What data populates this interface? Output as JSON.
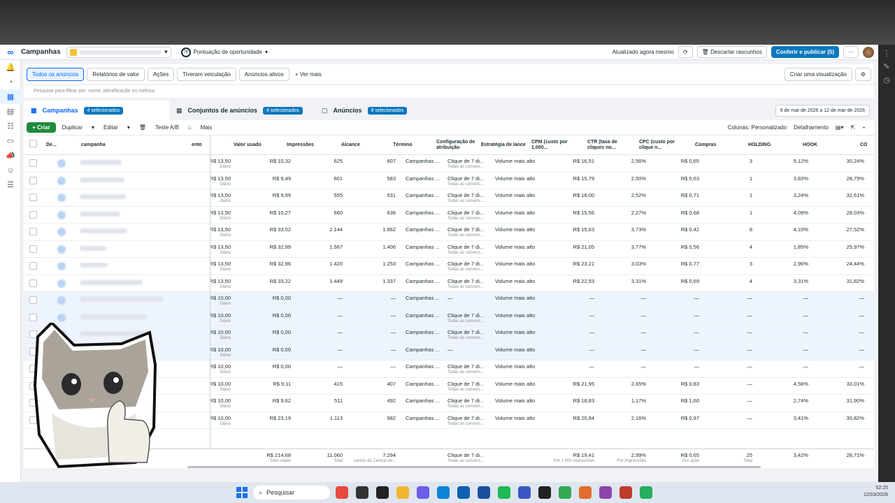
{
  "header": {
    "title": "Campanhas",
    "score_value": "78",
    "score_label": "Pontuação de oportunidade",
    "updated": "Atualizado agora mesmo",
    "discard": "Descartar rascunhos",
    "publish": "Conferir e publicar (5)"
  },
  "tabs": [
    "Todos os anúncios",
    "Relatórios de valor",
    "Ações",
    "Tiveram veiculação",
    "Anúncios ativos",
    "+ Ver mais"
  ],
  "create_view": "Criar uma visualização",
  "filter_placeholder": "Pesquise para filtrar por: nome, identificação ou métrica",
  "levels": {
    "campaigns": "Campanhas",
    "campaigns_sel": "4 selecionados",
    "adsets": "Conjuntos de anúncios",
    "adsets_sel": "4 selecionados",
    "ads": "Anúncios",
    "ads_sel": "8 selecionados",
    "date_range": "9 de mar de 2026 a 12 de mar de 2026"
  },
  "actions": {
    "create": "+ Criar",
    "duplicate": "Duplicar",
    "edit": "Editar",
    "abtest": "Teste A/B",
    "more": "Mais",
    "columns": "Colunas: Personalizado",
    "breakdown": "Detalhamento"
  },
  "columns": [
    "De...",
    "campanha",
    "ento",
    "Valor usado",
    "Impressões",
    "Alcance",
    "Término",
    "Configuração de atribuição",
    "Estratégia de lance",
    "CPM (custo por 1.000...",
    "CTR (taxa de cliques no...",
    "CPC (custo por clique n...",
    "Compras",
    "HOLDING",
    "HOOK",
    "CO"
  ],
  "rows": [
    {
      "budget": "R$ 13,50",
      "spent": "R$ 10,32",
      "impr": "625",
      "reach": "607",
      "end": "Campanhas ...",
      "attr": "Clique de 7 di...",
      "strategy": "Volume mais alto",
      "cpm": "R$ 16,51",
      "ctr": "2,56%",
      "cpc": "R$ 0,65",
      "purch": "3",
      "hold": "5,12%",
      "hook": "30,24%",
      "sel": false
    },
    {
      "budget": "R$ 13,50",
      "spent": "R$ 9,49",
      "impr": "601",
      "reach": "583",
      "end": "Campanhas ...",
      "attr": "Clique de 7 di...",
      "strategy": "Volume mais alto",
      "cpm": "R$ 15,79",
      "ctr": "2,50%",
      "cpc": "R$ 0,63",
      "purch": "1",
      "hold": "3,83%",
      "hook": "28,79%",
      "sel": false
    },
    {
      "budget": "R$ 13,50",
      "spent": "R$ 9,99",
      "impr": "555",
      "reach": "531",
      "end": "Campanhas ...",
      "attr": "Clique de 7 di...",
      "strategy": "Volume mais alto",
      "cpm": "R$ 18,00",
      "ctr": "2,52%",
      "cpc": "R$ 0,71",
      "purch": "1",
      "hold": "3,24%",
      "hook": "32,61%",
      "sel": false
    },
    {
      "budget": "R$ 13,50",
      "spent": "R$ 10,27",
      "impr": "660",
      "reach": "636",
      "end": "Campanhas ...",
      "attr": "Clique de 7 di...",
      "strategy": "Volume mais alto",
      "cpm": "R$ 15,56",
      "ctr": "2,27%",
      "cpc": "R$ 0,68",
      "purch": "1",
      "hold": "4,09%",
      "hook": "28,03%",
      "sel": false
    },
    {
      "budget": "R$ 13,50",
      "spent": "R$ 33,52",
      "impr": "2.144",
      "reach": "1.862",
      "end": "Campanhas ...",
      "attr": "Clique de 7 di...",
      "strategy": "Volume mais alto",
      "cpm": "R$ 15,63",
      "ctr": "3,73%",
      "cpc": "R$ 0,42",
      "purch": "8",
      "hold": "4,10%",
      "hook": "27,52%",
      "sel": false
    },
    {
      "budget": "R$ 13,50",
      "spent": "R$ 32,99",
      "impr": "1.567",
      "reach": "1.406",
      "end": "Campanhas ...",
      "attr": "Clique de 7 di...",
      "strategy": "Volume mais alto",
      "cpm": "R$ 21,05",
      "ctr": "3,77%",
      "cpc": "R$ 0,56",
      "purch": "4",
      "hold": "1,85%",
      "hook": "25,97%",
      "sel": false
    },
    {
      "budget": "R$ 13,50",
      "spent": "R$ 32,96",
      "impr": "1.420",
      "reach": "1.253",
      "end": "Campanhas ...",
      "attr": "Clique de 7 di...",
      "strategy": "Volume mais alto",
      "cpm": "R$ 23,21",
      "ctr": "3,03%",
      "cpc": "R$ 0,77",
      "purch": "3",
      "hold": "2,96%",
      "hook": "24,44%",
      "sel": false
    },
    {
      "budget": "R$ 13,50",
      "spent": "R$ 33,22",
      "impr": "1.449",
      "reach": "1.337",
      "end": "Campanhas ...",
      "attr": "Clique de 7 di...",
      "strategy": "Volume mais alto",
      "cpm": "R$ 22,93",
      "ctr": "3,31%",
      "cpc": "R$ 0,69",
      "purch": "4",
      "hold": "3,31%",
      "hook": "31,82%",
      "sel": false
    },
    {
      "budget": "R$ 10,00",
      "spent": "R$ 0,00",
      "impr": "—",
      "reach": "—",
      "end": "Campanhas ...",
      "attr": "—",
      "strategy": "Volume mais alto",
      "cpm": "—",
      "ctr": "—",
      "cpc": "—",
      "purch": "—",
      "hold": "—",
      "hook": "—",
      "sel": true
    },
    {
      "budget": "R$ 10,00",
      "spent": "R$ 0,00",
      "impr": "—",
      "reach": "—",
      "end": "Campanhas ...",
      "attr": "Clique de 7 di...",
      "strategy": "Volume mais alto",
      "cpm": "—",
      "ctr": "—",
      "cpc": "—",
      "purch": "—",
      "hold": "—",
      "hook": "—",
      "sel": true
    },
    {
      "budget": "R$ 10,00",
      "spent": "R$ 0,00",
      "impr": "—",
      "reach": "—",
      "end": "Campanhas ...",
      "attr": "Clique de 7 di...",
      "strategy": "Volume mais alto",
      "cpm": "—",
      "ctr": "—",
      "cpc": "—",
      "purch": "—",
      "hold": "—",
      "hook": "—",
      "sel": true
    },
    {
      "budget": "R$ 10,00",
      "spent": "R$ 0,00",
      "impr": "—",
      "reach": "—",
      "end": "Campanhas ...",
      "attr": "—",
      "strategy": "Volume mais alto",
      "cpm": "—",
      "ctr": "—",
      "cpc": "—",
      "purch": "—",
      "hold": "—",
      "hook": "—",
      "sel": true
    },
    {
      "budget": "R$ 10,00",
      "spent": "R$ 0,00",
      "impr": "—",
      "reach": "—",
      "end": "Campanhas ...",
      "attr": "Clique de 7 di...",
      "strategy": "Volume mais alto",
      "cpm": "—",
      "ctr": "—",
      "cpc": "—",
      "purch": "—",
      "hold": "—",
      "hook": "—",
      "sel": false
    },
    {
      "budget": "R$ 10,00",
      "spent": "R$ 9,11",
      "impr": "415",
      "reach": "407",
      "end": "Campanhas ...",
      "attr": "Clique de 7 di...",
      "strategy": "Volume mais alto",
      "cpm": "R$ 21,95",
      "ctr": "2,65%",
      "cpc": "R$ 0,83",
      "purch": "—",
      "hold": "4,56%",
      "hook": "33,01%",
      "sel": false
    },
    {
      "budget": "R$ 10,00",
      "spent": "R$ 9,62",
      "impr": "511",
      "reach": "492",
      "end": "Campanhas ...",
      "attr": "Clique de 7 di...",
      "strategy": "Volume mais alto",
      "cpm": "R$ 18,83",
      "ctr": "1,17%",
      "cpc": "R$ 1,60",
      "purch": "—",
      "hold": "2,74%",
      "hook": "31,90%",
      "sel": false
    },
    {
      "budget": "R$ 10,00",
      "spent": "R$ 23,19",
      "impr": "1.113",
      "reach": "982",
      "end": "Campanhas ...",
      "attr": "Clique de 7 di...",
      "strategy": "Volume mais alto",
      "cpm": "R$ 20,84",
      "ctr": "2,16%",
      "cpc": "R$ 0,97",
      "purch": "—",
      "hold": "3,41%",
      "hook": "30,82%",
      "sel": false
    }
  ],
  "row_sub": {
    "budget": "Diário",
    "attr": "Todas as convers..."
  },
  "totals": {
    "spent": "R$ 214,68",
    "spent_sub": "Total usado",
    "impr": "11.060",
    "impr_sub": "Total",
    "reach": "7.294",
    "reach_sub": "contas da Central de...",
    "attr": "Clique de 7 di...",
    "attr_sub": "Todas as convers...",
    "cpm": "R$ 19,41",
    "cpm_sub": "Por 1.000 impressões",
    "ctr": "2,99%",
    "ctr_sub": "Por impressões",
    "cpc": "R$ 0,65",
    "cpc_sub": "Por ação",
    "purch": "25",
    "purch_sub": "Total",
    "hold": "3,42%",
    "hook": "28,71%"
  },
  "taskbar": {
    "search": "Pesquisar",
    "time": "02:25",
    "date": "12/03/2026"
  }
}
